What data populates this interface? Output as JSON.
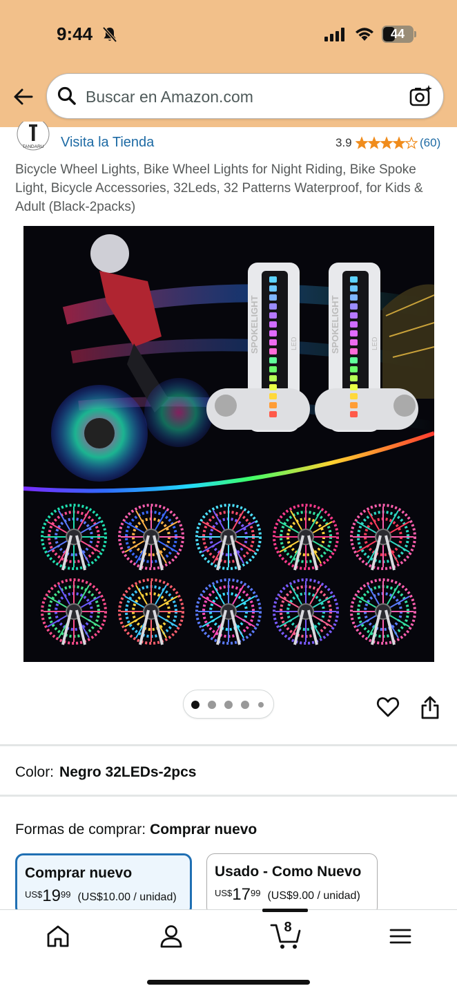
{
  "status_bar": {
    "time": "9:44",
    "battery": "44",
    "icons": [
      "bell-slash-icon",
      "cellular-signal-icon",
      "wifi-icon",
      "battery-icon"
    ]
  },
  "header": {
    "back_icon": "arrow-left-icon",
    "search_placeholder": "Buscar en Amazon.com",
    "search_icon": "search-icon",
    "camera_icon": "camera-search-icon"
  },
  "store": {
    "logo_text": "TANDARU",
    "link_text": "Visita la Tienda",
    "rating_value": "3.9",
    "stars_filled": 3.9,
    "rating_count": "(60)"
  },
  "product": {
    "title": "Bicycle Wheel Lights, Bike Wheel Lights for Night Riding, Bike Spoke Light, Bicycle Accessories, 32Leds, 32 Patterns Waterproof, for Kids & Adult (Black-2packs)",
    "image_labels": [
      "SPOKELIGHT",
      "LED",
      "SPOKELIGHT",
      "LED"
    ],
    "carousel": {
      "total": 5,
      "active_index": 0
    }
  },
  "color": {
    "label": "Color:",
    "value": "Negro 32LEDs-2pcs"
  },
  "formas": {
    "label": "Formas de comprar:",
    "value": "Comprar nuevo"
  },
  "buy_options": [
    {
      "title": "Comprar nuevo",
      "currency": "US$",
      "whole": "19",
      "fraction": "99",
      "unit_price": "(US$10.00 / unidad)",
      "selected": true
    },
    {
      "title": "Usado - Como Nuevo",
      "currency": "US$",
      "whole": "17",
      "fraction": "99",
      "unit_price": "(US$9.00 / unidad)",
      "selected": false
    }
  ],
  "tabbar": {
    "cart_count": "8",
    "tabs": [
      "home-icon",
      "account-icon",
      "cart-icon",
      "menu-icon"
    ]
  },
  "colors": {
    "header_bg": "#f2c08a",
    "link": "#1d6aa4",
    "star": "#f08c1c",
    "selected_border": "#1f6fb3"
  }
}
